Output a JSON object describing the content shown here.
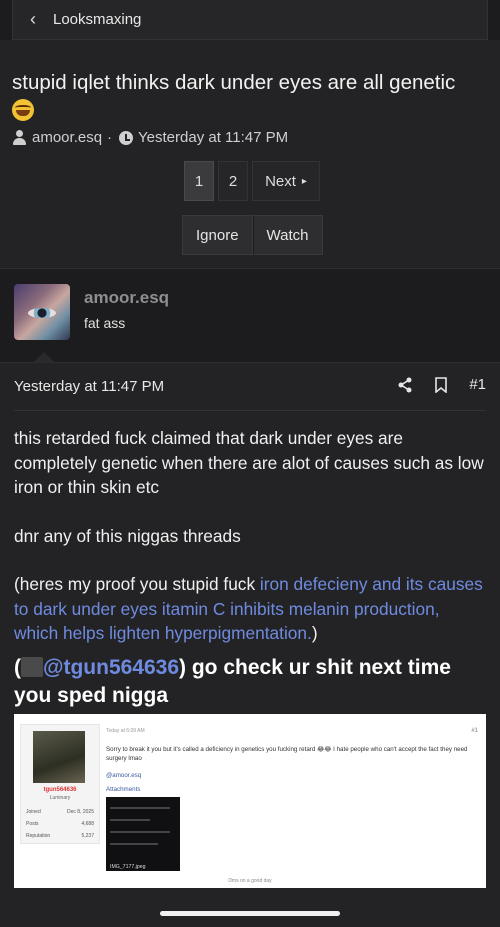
{
  "nav": {
    "back_icon": "chevron-left-icon",
    "breadcrumb": "Looksmaxing"
  },
  "thread": {
    "title": "stupid iqlet thinks dark under eyes are all genetic",
    "title_emoji": "rolling-on-floor-laughing-emoji",
    "author": "amoor.esq",
    "separator": "·",
    "time": "Yesterday at 11:47 PM"
  },
  "pagination": {
    "pages": [
      "1",
      "2"
    ],
    "current": "1",
    "next": "Next",
    "next_icon": "▸"
  },
  "actions": {
    "ignore": "Ignore",
    "watch": "Watch"
  },
  "poster": {
    "name": "amoor.esq",
    "title": "fat ass"
  },
  "post": {
    "date": "Yesterday at 11:47 PM",
    "number": "#1",
    "p1": "this retarded fuck claimed that dark under eyes are completely genetic when there are alot of causes such as low iron or thin skin etc",
    "p2": "dnr any of this niggas threads",
    "p3_open": "(heres my proof you stupid fuck ",
    "p3_link": "iron defecieny and its causes to dark under eyes itamin C inhibits melanin production, which helps lighten hyperpigmentation.",
    "p3_close": ")",
    "big_open": "(",
    "big_mention": "@tgun564636",
    "big_rest": ") go check ur shit next time you sped nigga"
  },
  "screenshot": {
    "username": "tgun564636",
    "rank": "Luminary",
    "rows": [
      {
        "label": "Joined",
        "value": "Dec 8, 2025"
      },
      {
        "label": "Posts",
        "value": "4,688"
      },
      {
        "label": "Reputation",
        "value": "5,237"
      }
    ],
    "meta": "Today at 6:09 AM",
    "text": "Sorry to break it you but it's called a deficiency in genetics you fucking retard 😂😂 I hate people who can't accept the fact they need surgery lmao",
    "mention": "@amoor.esq",
    "attachments": "Attachments",
    "file": "IMG_7177.jpeg",
    "footer": "Dms on a good day",
    "post_no": "#1"
  },
  "colors": {
    "background": "#1c1c1e",
    "link": "#6f8be0",
    "username": "#8e8e93"
  }
}
